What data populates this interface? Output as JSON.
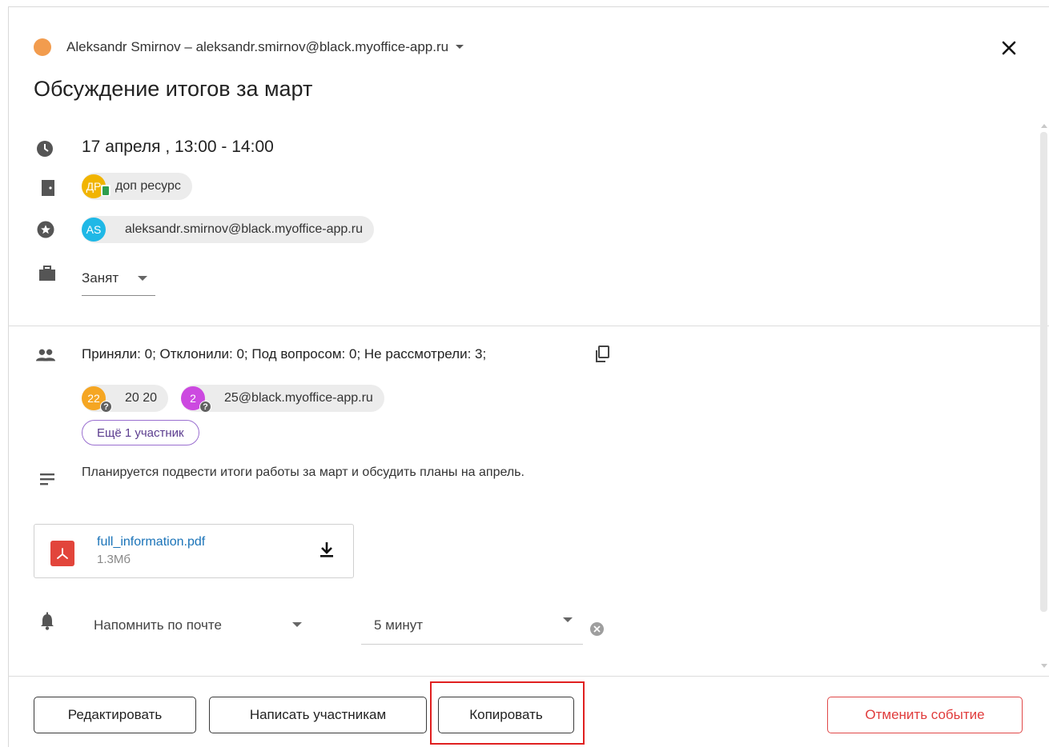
{
  "header": {
    "account": "Aleksandr Smirnov – aleksandr.smirnov@black.myoffice-app.ru",
    "account_dot_color": "#f29c4e",
    "close_icon": "close-icon"
  },
  "event": {
    "title": "Обсуждение итогов за март",
    "time": "17 апреля , 13:00 - 14:00",
    "resource": {
      "initials": "ДР",
      "name": "доп ресурс",
      "color": "#f1b400"
    },
    "organizer": {
      "initials": "AS",
      "email": "aleksandr.smirnov@black.myoffice-app.ru",
      "color": "#1fb8e6"
    },
    "status": "Занят"
  },
  "participants": {
    "stats": "Приняли: 0; Отклонили: 0; Под вопросом: 0; Не рассмотрели: 3;",
    "list": [
      {
        "initials": "22",
        "name": "20 20",
        "color": "#f5a623"
      },
      {
        "initials": "2",
        "name": "25@black.myoffice-app.ru",
        "color": "#cc49e0"
      }
    ],
    "more_label": "Ещё 1 участник"
  },
  "description": "Планируется подвести итоги работы за март и обсудить планы на апрель.",
  "attachment": {
    "name": "full_information.pdf",
    "size": "1.3Мб"
  },
  "reminder": {
    "type": "Напомнить по почте",
    "time": "5 минут"
  },
  "footer": {
    "edit": "Редактировать",
    "write": "Написать участникам",
    "copy": "Копировать",
    "cancel": "Отменить событие"
  },
  "colors": {
    "accent_purple": "#9a6fd0",
    "danger": "#e03c3c",
    "link": "#1a73b8",
    "highlight": "#e02020"
  }
}
